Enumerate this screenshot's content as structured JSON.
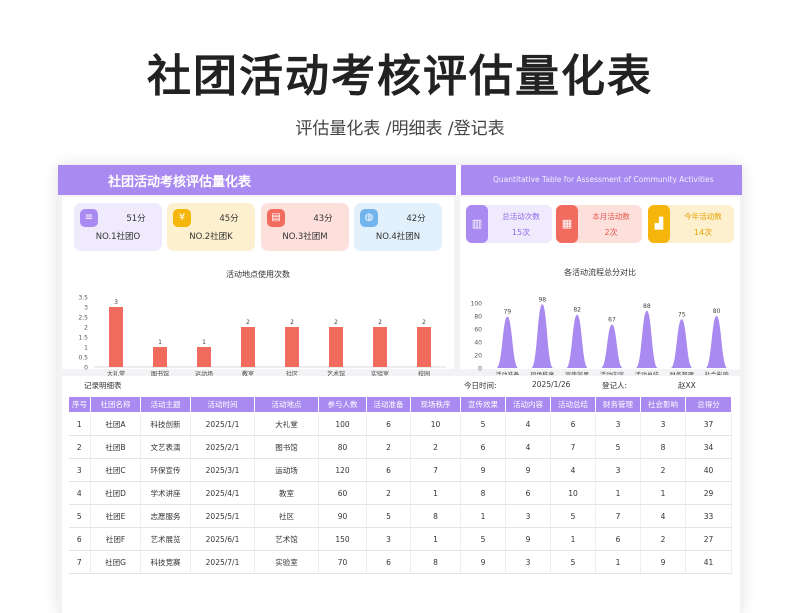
{
  "page": {
    "title": "社团活动考核评估量化表",
    "subtitle": "评估量化表 /明细表 /登记表"
  },
  "banner": {
    "title": "社团活动考核评估量化表",
    "english": "Quantitative Table for Assessment of Community Activities"
  },
  "rank_cards": [
    {
      "score": "51分",
      "name": "NO.1社团O",
      "icon": "stack-icon",
      "color": "#a98af0",
      "bg": "#efeafc"
    },
    {
      "score": "45分",
      "name": "NO.2社团K",
      "icon": "coin-icon",
      "color": "#f5b50a",
      "bg": "#fdf0cf"
    },
    {
      "score": "43分",
      "name": "NO.3社团M",
      "icon": "database-icon",
      "color": "#f26b5f",
      "bg": "#fde0dc"
    },
    {
      "score": "42分",
      "name": "NO.4社团N",
      "icon": "globe-icon",
      "color": "#72b4ec",
      "bg": "#e2f0fc"
    }
  ],
  "summary_cards": [
    {
      "label": "总活动次数",
      "value": "15次",
      "icon": "bar-chart-icon",
      "color": "#a98af0",
      "bg": "#efeafc",
      "fg": "#8f6ae8"
    },
    {
      "label": "本月活动数",
      "value": "2次",
      "icon": "calendar-chart-icon",
      "color": "#f26b5f",
      "bg": "#fde0dc",
      "fg": "#e2594e"
    },
    {
      "label": "今年活动数",
      "value": "14次",
      "icon": "growth-chart-icon",
      "color": "#f5b50a",
      "bg": "#fdf0cf",
      "fg": "#e5a200"
    }
  ],
  "chart_data": [
    {
      "type": "bar",
      "title": "活动地点使用次数",
      "categories": [
        "大礼堂",
        "图书馆",
        "运动场",
        "教室",
        "社区",
        "艺术馆",
        "实验室",
        "校园"
      ],
      "values": [
        3,
        1,
        1,
        2,
        2,
        2,
        2,
        2
      ],
      "ylim": [
        0,
        3.5
      ],
      "yticks": [
        "0",
        "0.5",
        "1",
        "1.5",
        "2",
        "2.5",
        "3",
        "3.5"
      ],
      "color": "#f26b5f",
      "grid": false
    },
    {
      "type": "area",
      "title": "各活动流程总分对比",
      "categories": [
        "活动准备",
        "现场秩序",
        "宣传效果",
        "活动内容",
        "活动总结",
        "财务管理",
        "社会影响"
      ],
      "values": [
        79,
        98,
        82,
        67,
        88,
        75,
        80
      ],
      "ylim": [
        0,
        100
      ],
      "yticks": [
        "0",
        "20",
        "40",
        "60",
        "80",
        "100"
      ],
      "color": "#a98af0",
      "grid": false
    }
  ],
  "table": {
    "label": "记录明细表",
    "date_label": "今日时间:",
    "date_value": "2025/1/26",
    "registrar_label": "登记人:",
    "registrar_value": "赵XX",
    "columns": [
      "序号",
      "社团名称",
      "活动主题",
      "活动时间",
      "活动地点",
      "参与人数",
      "活动准备",
      "现场秩序",
      "宣传效果",
      "活动内容",
      "活动总结",
      "财务管理",
      "社会影响",
      "总得分"
    ],
    "rows": [
      [
        "1",
        "社团A",
        "科技创新",
        "2025/1/1",
        "大礼堂",
        "100",
        "6",
        "10",
        "5",
        "4",
        "6",
        "3",
        "3",
        "37"
      ],
      [
        "2",
        "社团B",
        "文艺表演",
        "2025/2/1",
        "图书馆",
        "80",
        "2",
        "2",
        "6",
        "4",
        "7",
        "5",
        "8",
        "34"
      ],
      [
        "3",
        "社团C",
        "环保宣传",
        "2025/3/1",
        "运动场",
        "120",
        "6",
        "7",
        "9",
        "9",
        "4",
        "3",
        "2",
        "40"
      ],
      [
        "4",
        "社团D",
        "学术讲座",
        "2025/4/1",
        "教室",
        "60",
        "2",
        "1",
        "8",
        "6",
        "10",
        "1",
        "1",
        "29"
      ],
      [
        "5",
        "社团E",
        "志愿服务",
        "2025/5/1",
        "社区",
        "90",
        "5",
        "8",
        "1",
        "3",
        "5",
        "7",
        "4",
        "33"
      ],
      [
        "6",
        "社团F",
        "艺术展览",
        "2025/6/1",
        "艺术馆",
        "150",
        "3",
        "1",
        "5",
        "9",
        "1",
        "6",
        "2",
        "27"
      ],
      [
        "7",
        "社团G",
        "科技竞赛",
        "2025/7/1",
        "实验室",
        "70",
        "6",
        "8",
        "9",
        "3",
        "5",
        "1",
        "9",
        "41"
      ]
    ]
  }
}
